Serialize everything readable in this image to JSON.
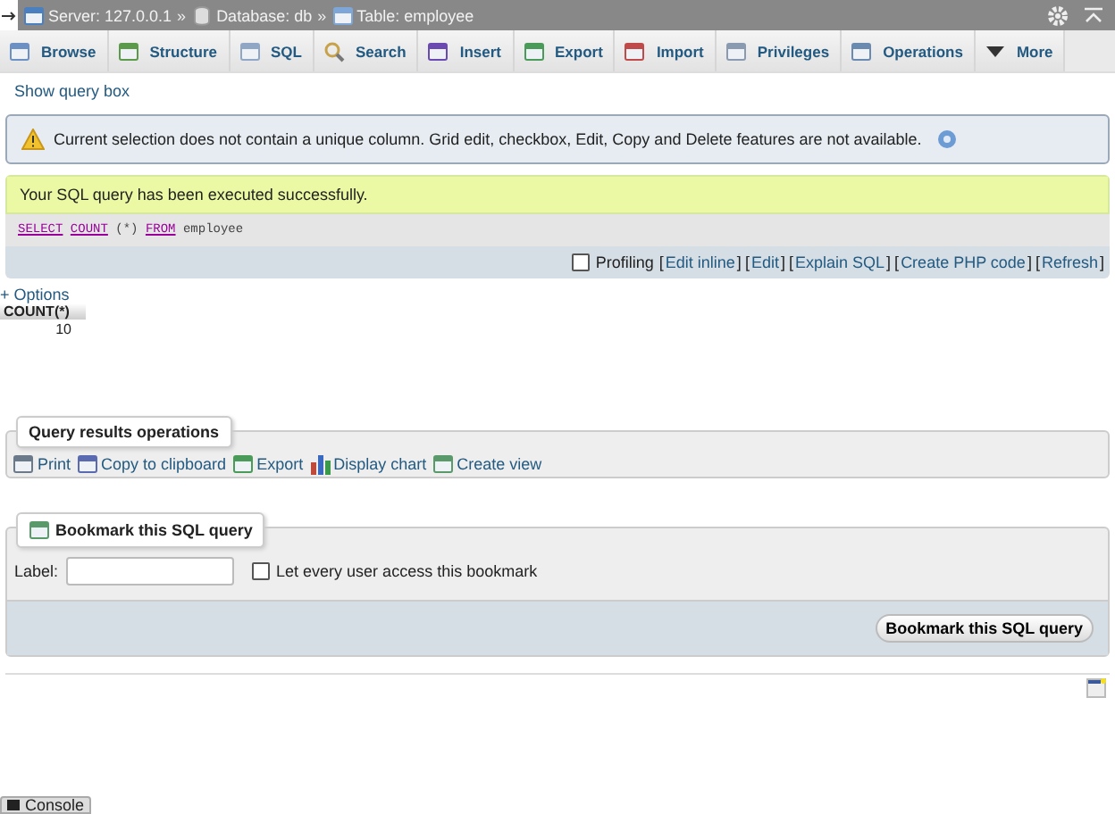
{
  "breadcrumb": [
    {
      "kind": "server",
      "label": "Server: 127.0.0.1"
    },
    {
      "kind": "database",
      "label": "Database: db"
    },
    {
      "kind": "table",
      "label": "Table: employee"
    }
  ],
  "breadcrumb_separator": "»",
  "tabs": [
    {
      "label": "Browse",
      "selected": false
    },
    {
      "label": "Structure",
      "selected": false
    },
    {
      "label": "SQL",
      "selected": false
    },
    {
      "label": "Search",
      "selected": false
    },
    {
      "label": "Insert",
      "selected": false
    },
    {
      "label": "Export",
      "selected": false
    },
    {
      "label": "Import",
      "selected": false
    },
    {
      "label": "Privileges",
      "selected": false
    },
    {
      "label": "Operations",
      "selected": false
    },
    {
      "label": "More",
      "selected": false
    }
  ],
  "show_query_link": "Show query box",
  "notice": "Current selection does not contain a unique column. Grid edit, checkbox, Edit, Copy and Delete features are not available.",
  "success_message": "Your SQL query has been executed successfully.",
  "sql": [
    {
      "kind": "keyword",
      "text": "SELECT"
    },
    {
      "kind": "function",
      "text": "COUNT"
    },
    {
      "kind": "plain",
      "text": "(*)"
    },
    {
      "kind": "keyword",
      "text": "FROM"
    },
    {
      "kind": "plain",
      "text": "employee"
    }
  ],
  "profiling": {
    "label": "Profiling",
    "checked": false
  },
  "query_links": [
    {
      "open": "[",
      "label": "Edit inline",
      "close": "]"
    },
    {
      "open": "[",
      "label": "Edit",
      "close": "]"
    },
    {
      "open": "[",
      "label": "Explain SQL",
      "close": "]"
    },
    {
      "open": "[",
      "label": "Create PHP code",
      "close": "]"
    },
    {
      "open": "[",
      "label": "Refresh",
      "close": "]"
    }
  ],
  "options_link": "+ Options",
  "results": {
    "columns": [
      "COUNT(*)"
    ],
    "rows": [
      [
        "10"
      ]
    ]
  },
  "operations": {
    "legend": "Query results operations",
    "links": [
      "Print",
      "Copy to clipboard",
      "Export",
      "Display chart",
      "Create view"
    ]
  },
  "bookmark": {
    "legend": "Bookmark this SQL query",
    "label": "Label:",
    "share_label": "Let every user access this bookmark",
    "share_checked": false,
    "button": "Bookmark this SQL query"
  },
  "console": "Console"
}
